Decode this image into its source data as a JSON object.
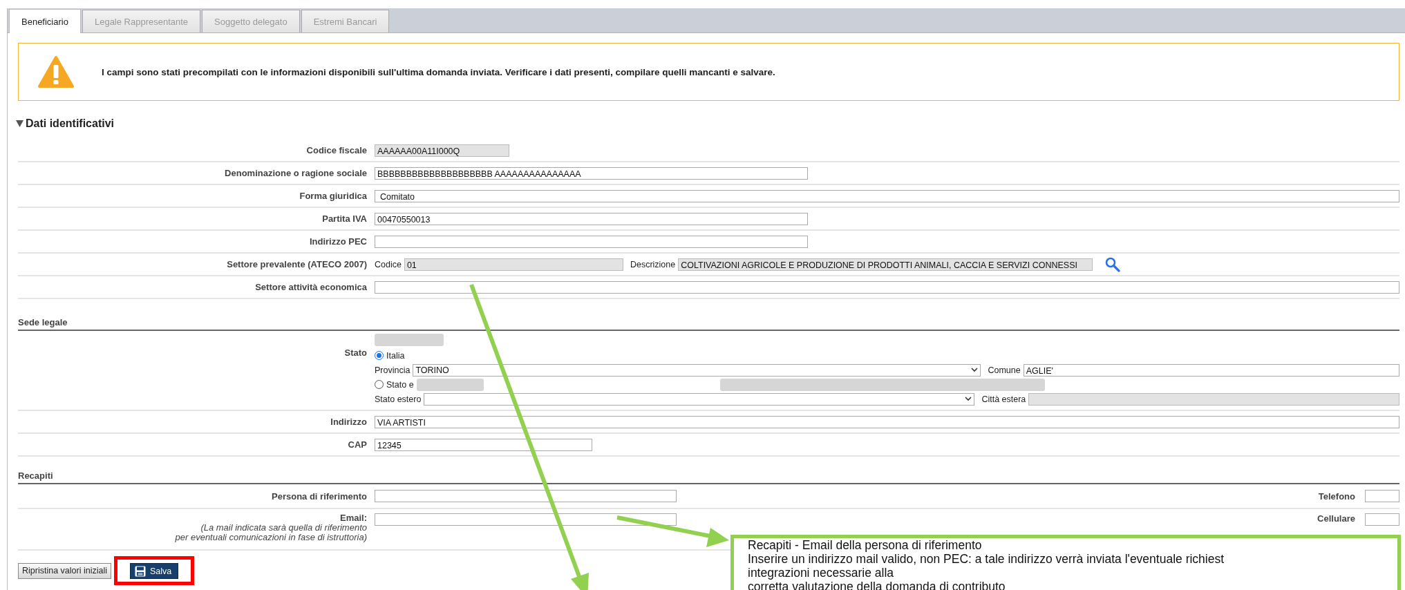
{
  "tabs": [
    {
      "label": "Beneficiario",
      "selected": true
    },
    {
      "label": "Legale Rappresentante",
      "selected": false
    },
    {
      "label": "Soggetto delegato",
      "selected": false
    },
    {
      "label": "Estremi Bancari",
      "selected": false
    }
  ],
  "notice": {
    "text": "I campi sono stati precompilati con le informazioni disponibili sull'ultima domanda inviata. Verificare i dati presenti, compilare quelli mancanti e salvare."
  },
  "identification": {
    "title": "Dati identificativi",
    "expanded": true,
    "rows": [
      {
        "label": "Codice fiscale",
        "kind": "readonly",
        "value": "AAAAAA00A11I000Q"
      },
      {
        "label": "Denominazione o ragione sociale",
        "kind": "text",
        "value": "BBBBBBBBBBBBBBBBBBBB AAAAAAAAAAAAAAA"
      },
      {
        "label": "Forma giuridica",
        "kind": "select",
        "value": "Comitato"
      },
      {
        "label": "Partita IVA",
        "kind": "text",
        "value": "00470550013"
      },
      {
        "label": "Indirizzo PEC",
        "kind": "text"
      },
      {
        "label": "Settore prevalente (ATECO 2007)",
        "kind": "ateco",
        "code_label": "Codice",
        "code": "01",
        "description_label": "Descrizione",
        "description": "COLTIVAZIONI AGRICOLE E PRODUZIONE DI PRODOTTI ANIMALI, CACCIA E SERVIZI CONNESSI"
      },
      {
        "label": "Settore attività economica",
        "kind": "select"
      }
    ]
  },
  "registered_office": {
    "title": "Sede legale",
    "stato_label": "Stato",
    "options": [
      {
        "label": "Italia",
        "selected": true
      },
      {
        "label": "Stato e",
        "selected": false
      }
    ],
    "provincia_label": "Provincia",
    "provincia": "TORINO",
    "comune_label": "Comune",
    "comune": "AGLIE'",
    "estero_label": "Stato estero",
    "citta_label": "Città estera",
    "rows": [
      {
        "label": "Indirizzo",
        "value": "VIA ARTISTI"
      },
      {
        "label": "CAP",
        "value": "12345"
      }
    ]
  },
  "contacts": {
    "title": "Recapiti",
    "persona_label": "Persona di riferimento",
    "telefono_label": "Telefono",
    "email_label": "Email:",
    "email_note_lines": [
      "(La mail indicata sarà quella di riferimento",
      "per eventuali comunicazioni in fase di istruttoria)"
    ],
    "cellulare_label": "Cellulare"
  },
  "buttons": [
    {
      "label": "Ripristina valori iniziali",
      "kind": "reset"
    },
    {
      "label": "Salva",
      "kind": "save",
      "highlighted": true
    }
  ],
  "callout": {
    "lines": [
      "Recapiti - Email della persona di riferimento",
      "Inserire un indirizzo mail valido, non PEC: a tale indirizzo verrà inviata l'eventuale richiest",
      "integrazioni necessarie alla",
      "corretta valutazione della domanda di contributo"
    ]
  }
}
